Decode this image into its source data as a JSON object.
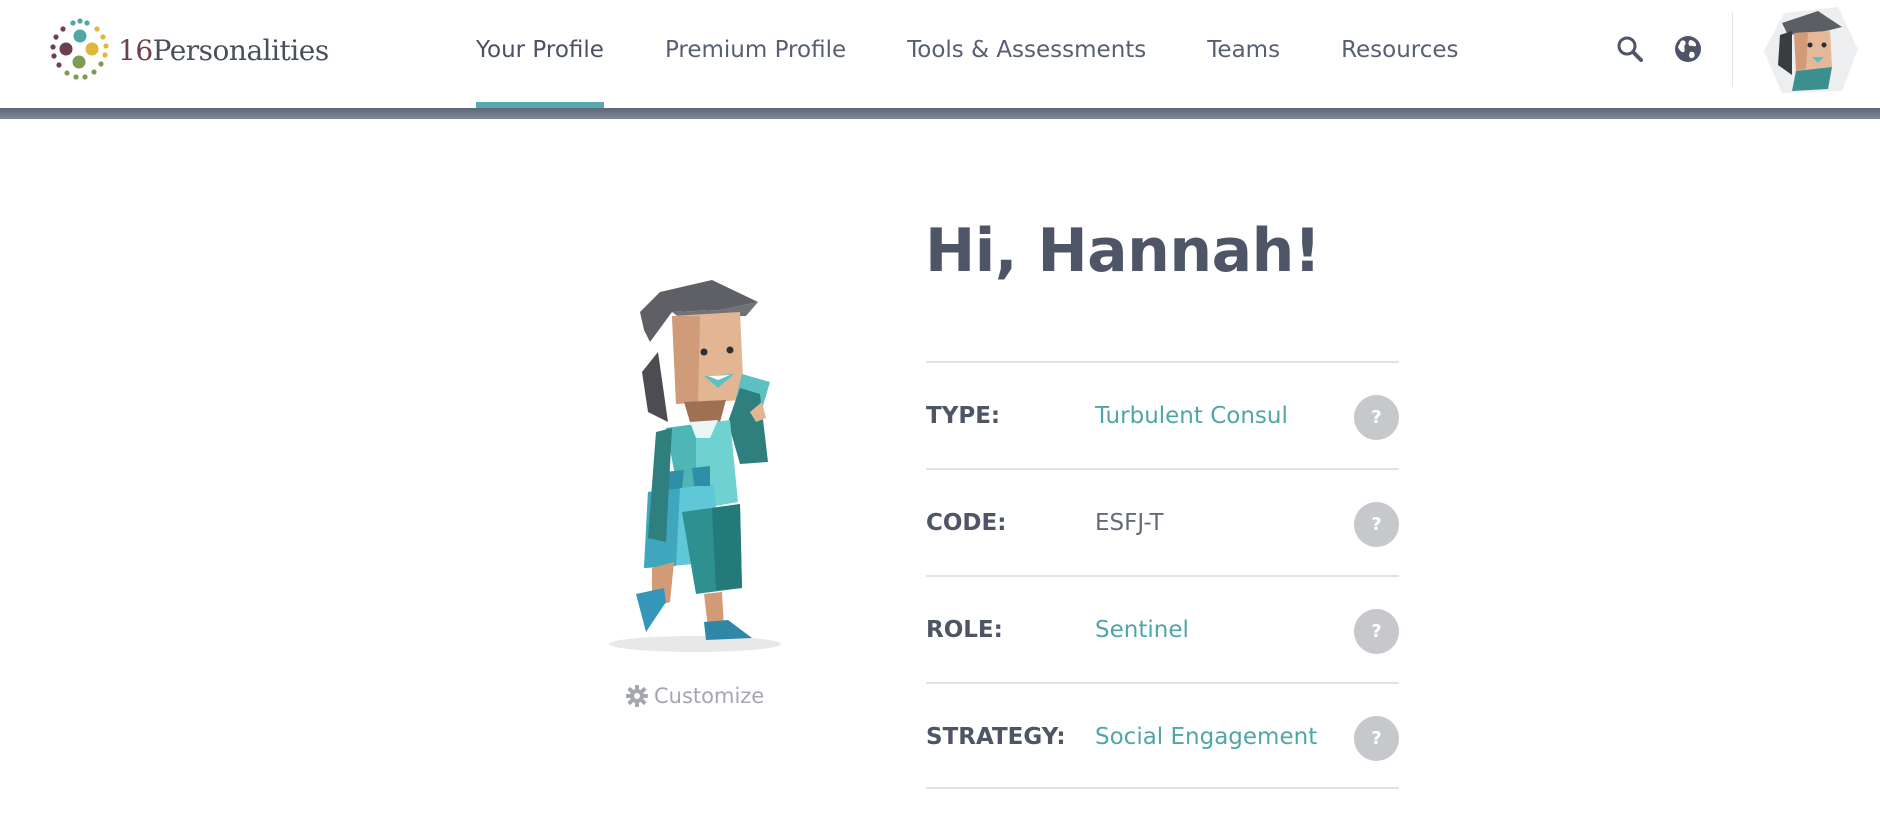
{
  "brand": {
    "logo_number": "16",
    "logo_text": "Personalities",
    "dot_colors": [
      "#4fa6a8",
      "#e0b73b",
      "#7d9d54",
      "#6f3f4d"
    ]
  },
  "nav": {
    "items": [
      {
        "label": "Your Profile",
        "active": true
      },
      {
        "label": "Premium Profile",
        "active": false
      },
      {
        "label": "Tools & Assessments",
        "active": false
      },
      {
        "label": "Teams",
        "active": false
      },
      {
        "label": "Resources",
        "active": false
      }
    ],
    "icons": [
      "search-icon",
      "globe-icon"
    ]
  },
  "avatar": {
    "icon": "user-avatar"
  },
  "greeting": "Hi, Hannah!",
  "customize_label": "Customize",
  "profile": {
    "rows": [
      {
        "label": "TYPE:",
        "value": "Turbulent Consul",
        "link": true,
        "help": "?"
      },
      {
        "label": "CODE:",
        "value": "ESFJ-T",
        "link": false,
        "help": "?"
      },
      {
        "label": "ROLE:",
        "value": "Sentinel",
        "link": true,
        "help": "?"
      },
      {
        "label": "STRATEGY:",
        "value": "Social Engagement",
        "link": true,
        "help": "?"
      }
    ]
  },
  "colors": {
    "accent": "#56a8ac",
    "link": "#4fa6a8",
    "text": "#4d5566",
    "help_button": "#c6c8cc"
  }
}
